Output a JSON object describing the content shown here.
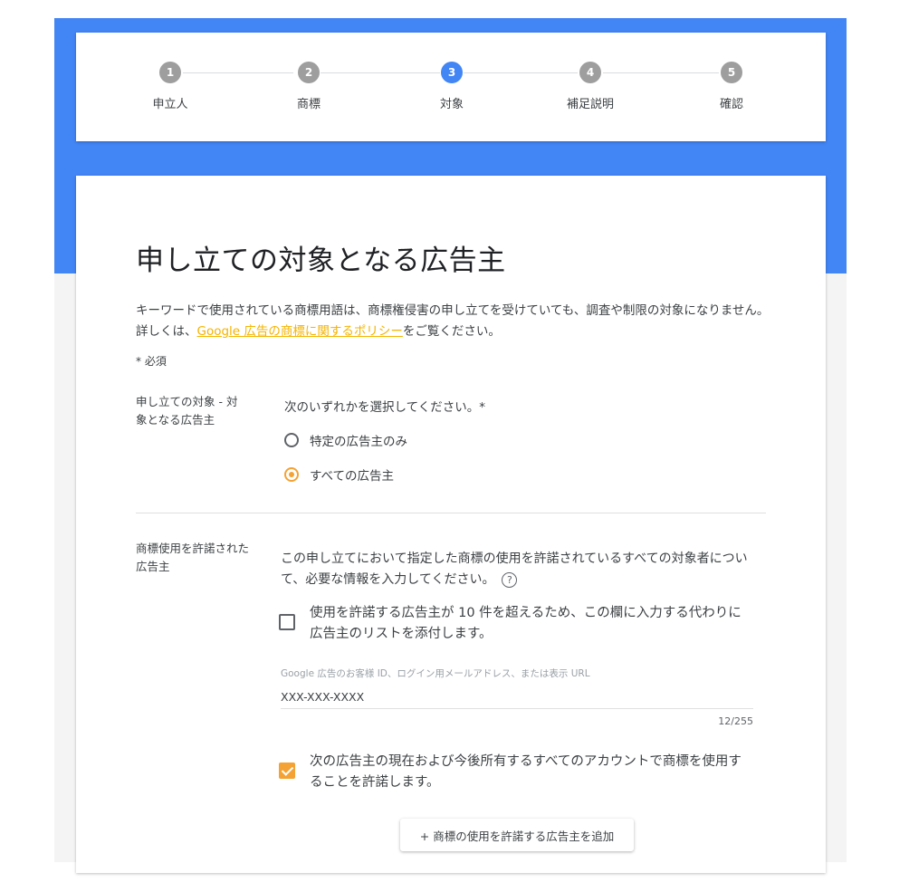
{
  "stepper": {
    "steps": [
      {
        "number": "1",
        "label": "申立人",
        "active": false
      },
      {
        "number": "2",
        "label": "商標",
        "active": false
      },
      {
        "number": "3",
        "label": "対象",
        "active": true
      },
      {
        "number": "4",
        "label": "補足説明",
        "active": false
      },
      {
        "number": "5",
        "label": "確認",
        "active": false
      }
    ]
  },
  "page": {
    "title": "申し立ての対象となる広告主",
    "description_before": "キーワードで使用されている商標用語は、商標権侵害の申し立てを受けていても、調査や制限の対象になりません。詳しくは、",
    "description_link": "Google 広告の商標に関するポリシー",
    "description_after": "をご覧ください。",
    "required_note": "* 必須"
  },
  "section_target": {
    "label": "申し立ての対象 - 対象となる広告主",
    "prompt": "次のいずれかを選択してください。*",
    "options": [
      {
        "label": "特定の広告主のみ",
        "selected": false
      },
      {
        "label": "すべての広告主",
        "selected": true
      }
    ]
  },
  "section_authorized": {
    "label": "商標使用を許諾された広告主",
    "description": "この申し立てにおいて指定した商標の使用を許諾されているすべての対象者について、必要な情報を入力してください。",
    "help_icon": "?",
    "attach_list_checkbox": {
      "label": "使用を許諾する広告主が 10 件を超えるため、この欄に入力する代わりに広告主のリストを添付します。",
      "checked": false
    },
    "field_label": "Google 広告のお客様 ID、ログイン用メールアドレス、または表示 URL",
    "field_value": "XXX-XXX-XXXX",
    "counter": "12/255",
    "all_accounts_checkbox": {
      "label": "次の広告主の現在および今後所有するすべてのアカウントで商標を使用することを許諾します。",
      "checked": true
    },
    "add_button": "+ 商標の使用を許諾する広告主を追加"
  },
  "colors": {
    "brand_blue": "#4285f4",
    "accent_orange": "#f4a233",
    "link_yellow": "#f4b400",
    "inactive_step": "#9e9e9e"
  }
}
